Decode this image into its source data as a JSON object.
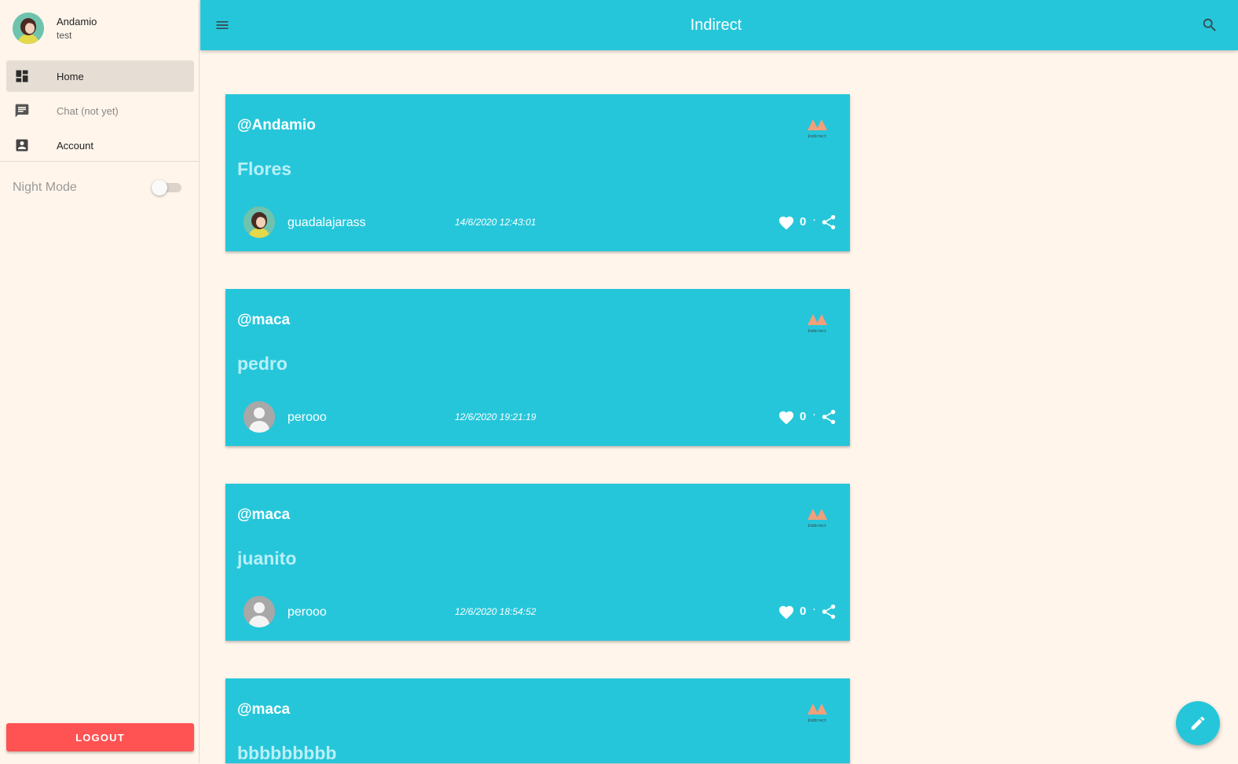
{
  "sidebar": {
    "profile": {
      "name": "Andamio",
      "subtitle": "test"
    },
    "items": [
      {
        "label": "Home",
        "icon": "dashboard-icon",
        "active": true
      },
      {
        "label": "Chat (not yet)",
        "icon": "chat-icon",
        "active": false
      },
      {
        "label": "Account",
        "icon": "account-box-icon",
        "active": false
      }
    ],
    "night_mode": {
      "label": "Night Mode",
      "enabled": false
    },
    "logout_label": "LOGOUT"
  },
  "header": {
    "title": "Indirect"
  },
  "posts": [
    {
      "user": "@Andamio",
      "title": "Flores",
      "author": "guadalajarass",
      "date": "14/6/2020 12:43:01",
      "likes": "0",
      "avatar": "illustrated"
    },
    {
      "user": "@maca",
      "title": "pedro",
      "author": "perooo",
      "date": "12/6/2020 19:21:19",
      "likes": "0",
      "avatar": "default"
    },
    {
      "user": "@maca",
      "title": "juanito",
      "author": "perooo",
      "date": "12/6/2020 18:54:52",
      "likes": "0",
      "avatar": "default"
    },
    {
      "user": "@maca",
      "title": "bbbbbbbbb",
      "author": "",
      "date": "",
      "likes": "",
      "avatar": ""
    }
  ],
  "logo_text": "Indirect",
  "colors": {
    "primary": "#26c6da",
    "background": "#fff5eb",
    "logout": "#ff5252",
    "logo": "#f0a07a",
    "title_text": "#b9f0f7"
  }
}
